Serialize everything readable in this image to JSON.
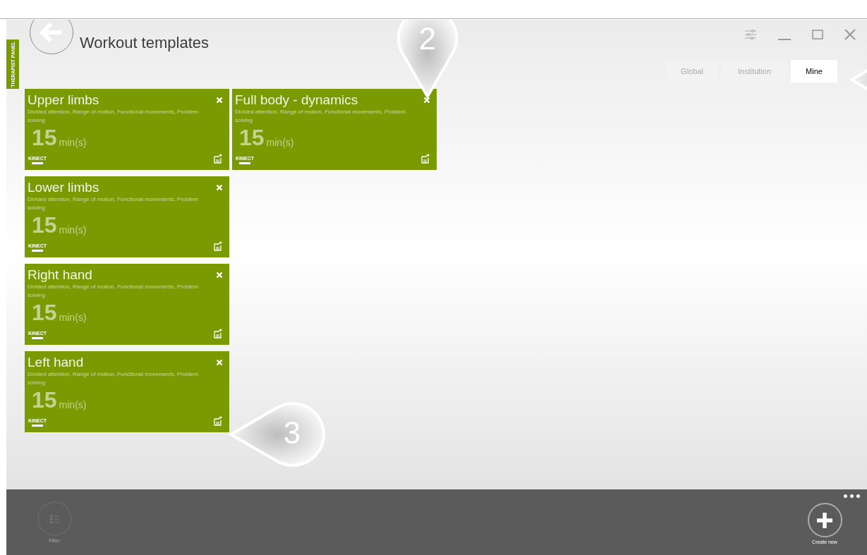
{
  "window": {
    "title": "Workout templates"
  },
  "side_tab": {
    "label": "THERAPIST PANEL"
  },
  "scope_tabs": [
    {
      "label": "Global",
      "selected": false
    },
    {
      "label": "Institution",
      "selected": false
    },
    {
      "label": "Mine",
      "selected": true
    }
  ],
  "templates": [
    {
      "title": "Upper limbs",
      "description": "Divided attention, Range of motion, Functional movements, Problem solving",
      "duration": "15",
      "unit": "min(s)",
      "device": "KINECT"
    },
    {
      "title": "Full body - dynamics",
      "description": "Divided attention, Range of motion, Functional movements, Problem solving",
      "duration": "15",
      "unit": "min(s)",
      "device": "KINECT"
    },
    {
      "title": "Lower limbs",
      "description": "Divided attention, Range of motion, Functional movements, Problem solving",
      "duration": "15",
      "unit": "min(s)",
      "device": "KINECT"
    },
    {
      "title": "Right hand",
      "description": "Divided attention, Range of motion, Functional movements, Problem solving",
      "duration": "15",
      "unit": "min(s)",
      "device": "KINECT"
    },
    {
      "title": "Left hand",
      "description": "Divided attention, Range of motion, Functional movements, Problem solving",
      "duration": "15",
      "unit": "min(s)",
      "device": "KINECT"
    }
  ],
  "callouts": [
    {
      "kind": "down",
      "number": "2"
    },
    {
      "kind": "left",
      "number": "3"
    },
    {
      "kind": "left-edge"
    }
  ],
  "app_bar": [
    {
      "kind": "filter",
      "label": "Filter",
      "disabled": true
    },
    {
      "kind": "create",
      "label": "Create new",
      "disabled": false
    }
  ]
}
